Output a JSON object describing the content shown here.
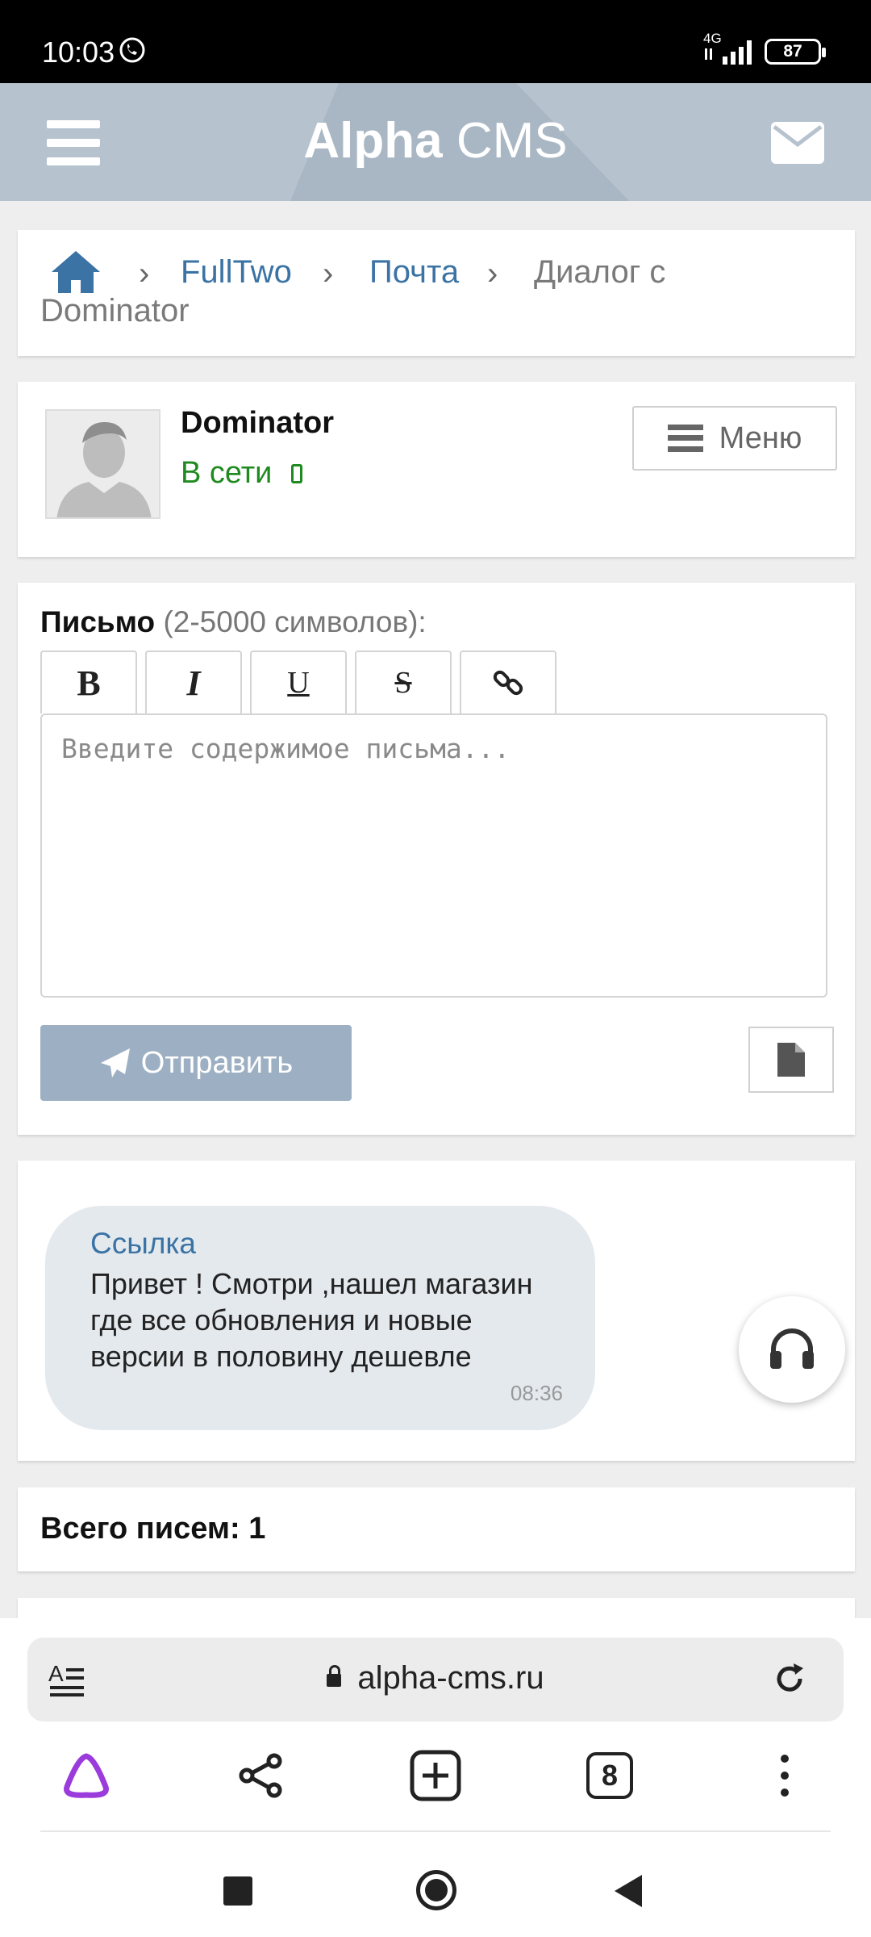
{
  "status_bar": {
    "time": "10:03",
    "network": "4G",
    "battery": "87"
  },
  "header": {
    "title_bold": "Alpha",
    "title_regular": "CMS",
    "accent_color": "#b6c3cf"
  },
  "breadcrumb": {
    "items": [
      "FullTwo",
      "Почта",
      "Диалог с",
      "Dominator"
    ]
  },
  "profile": {
    "name": "Dominator",
    "status": "В сети",
    "menu_label": "Меню"
  },
  "compose": {
    "label_bold": "Письмо",
    "label_hint": "(2-5000 символов):",
    "toolbar": [
      "B",
      "I",
      "U",
      "S"
    ],
    "placeholder": "Введите содержимое письма...",
    "send_label": "Отправить"
  },
  "message": {
    "link": "Ссылка",
    "text": "Привет ! Смотри ,нашел магазин где все обновления и новые версии в половину дешевле",
    "time": "08:36"
  },
  "summary": {
    "total": "Всего писем: 1"
  },
  "browser": {
    "url": "alpha-cms.ru",
    "tabs_count": "8"
  }
}
